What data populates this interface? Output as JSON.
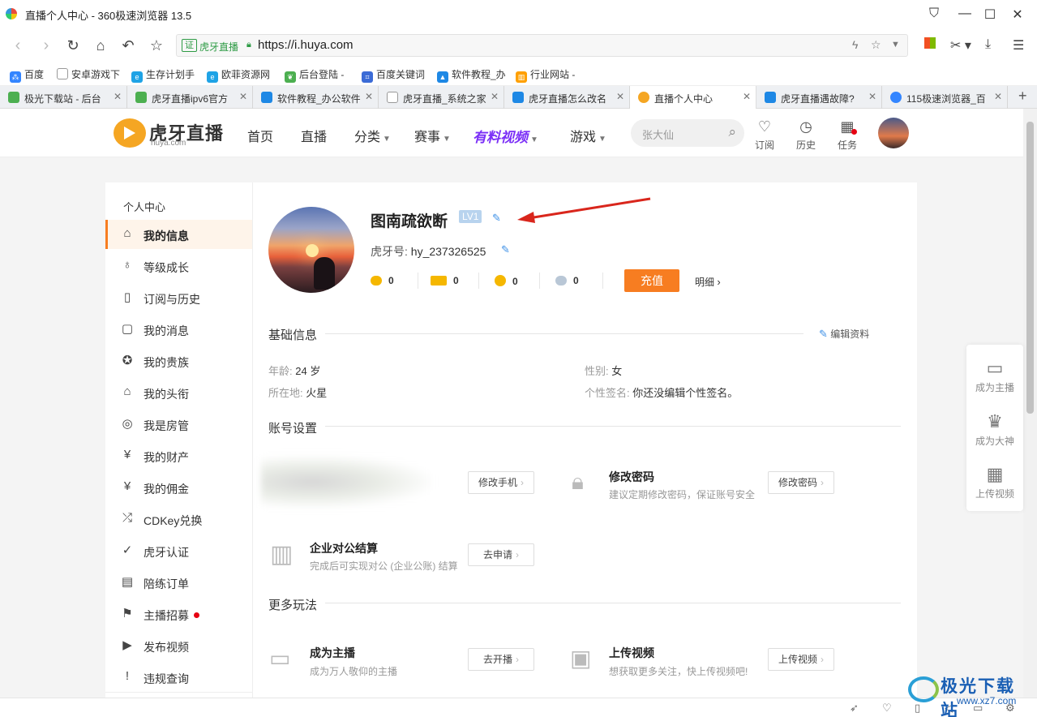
{
  "window": {
    "title": "直播个人中心 - 360极速浏览器 13.5",
    "controls": [
      "shirt-icon",
      "minimize-icon",
      "maximize-icon",
      "close-icon"
    ]
  },
  "address": {
    "cert": "证",
    "site_label": "虎牙直播",
    "url": "https://i.huya.com"
  },
  "bookmarks": [
    {
      "label": "百度",
      "icon": "baidu-icon",
      "color": "#3385ff"
    },
    {
      "label": "安卓游戏下",
      "icon": "page-icon",
      "color": "#9e9e9e"
    },
    {
      "label": "生存计划手",
      "icon": "edge-icon",
      "color": "#1fa3e6"
    },
    {
      "label": "欧菲资源网",
      "icon": "edge-icon",
      "color": "#1fa3e6"
    },
    {
      "label": "后台登陆 -",
      "icon": "leaf-icon",
      "color": "#4caf50"
    },
    {
      "label": "百度关键词",
      "icon": "crop-icon",
      "color": "#3b6bd6"
    },
    {
      "label": "软件教程_办",
      "icon": "cap-icon",
      "color": "#1e88e5"
    },
    {
      "label": "行业网站 -",
      "icon": "chart-icon",
      "color": "#ffa000"
    }
  ],
  "tabs": [
    {
      "label": "极光下载站 - 后台",
      "color": "#4caf50"
    },
    {
      "label": "虎牙直播ipv6官方",
      "color": "#4caf50"
    },
    {
      "label": "软件教程_办公软件",
      "color": "#1e88e5"
    },
    {
      "label": "虎牙直播_系统之家",
      "color": "#9e9e9e"
    },
    {
      "label": "虎牙直播怎么改名",
      "color": "#1e88e5"
    },
    {
      "label": "直播个人中心",
      "color": "#f5a623",
      "active": true
    },
    {
      "label": "虎牙直播遇故障?",
      "color": "#1e88e5"
    },
    {
      "label": "115极速浏览器_百",
      "color": "#3385ff"
    }
  ],
  "site": {
    "logo_text": "虎牙直播",
    "logo_sub": "huya.com",
    "nav": [
      {
        "label": "首页",
        "caret": false
      },
      {
        "label": "直播",
        "caret": false
      },
      {
        "label": "分类",
        "caret": true
      },
      {
        "label": "赛事",
        "caret": true
      },
      {
        "label": "有料视频",
        "caret": true
      },
      {
        "label": "游戏",
        "caret": true
      }
    ],
    "search_placeholder": "张大仙",
    "icons": [
      {
        "label": "订阅",
        "glyph": "♡"
      },
      {
        "label": "历史",
        "glyph": "◷"
      },
      {
        "label": "任务",
        "glyph": "▦"
      }
    ]
  },
  "sidebar": {
    "heading": "个人中心",
    "items": [
      {
        "label": "我的信息",
        "glyph": "⌂",
        "active": true
      },
      {
        "label": "等级成长",
        "glyph": "♁"
      },
      {
        "label": "订阅与历史",
        "glyph": "▯"
      },
      {
        "label": "我的消息",
        "glyph": "▢"
      },
      {
        "label": "我的贵族",
        "glyph": "✪"
      },
      {
        "label": "我的头衔",
        "glyph": "⌂"
      },
      {
        "label": "我是房管",
        "glyph": "◎"
      },
      {
        "label": "我的财产",
        "glyph": "¥"
      },
      {
        "label": "我的佣金",
        "glyph": "¥"
      },
      {
        "label": "CDKey兑换",
        "glyph": "⤮"
      },
      {
        "label": "虎牙认证",
        "glyph": "✓"
      },
      {
        "label": "陪练订单",
        "glyph": "▤"
      },
      {
        "label": "主播招募",
        "glyph": "⚑",
        "dot": true
      },
      {
        "label": "发布视频",
        "glyph": "▶"
      },
      {
        "label": "违规查询",
        "glyph": "!"
      }
    ]
  },
  "profile": {
    "name": "图南疏欲断",
    "level": "LV1",
    "hy_label": "虎牙号:",
    "hy_id": "hy_237326525",
    "coins": [
      "0",
      "0",
      "0",
      "0"
    ],
    "recharge": "充值",
    "detail": "明细"
  },
  "basic": {
    "title": "基础信息",
    "edit": "编辑资料",
    "age_label": "年龄:",
    "age_value": "24 岁",
    "gender_label": "性别:",
    "gender_value": "女",
    "loc_label": "所在地:",
    "loc_value": "火星",
    "sig_label": "个性签名:",
    "sig_value": "你还没编辑个性签名。"
  },
  "account": {
    "title": "账号设置",
    "phone_btn": "修改手机",
    "pwd_title": "修改密码",
    "pwd_desc": "建议定期修改密码，保证账号安全",
    "pwd_btn": "修改密码",
    "corp_title": "企业对公结算",
    "corp_desc": "完成后可实现对公 (企业公账) 结算",
    "corp_btn": "去申请"
  },
  "more": {
    "title": "更多玩法",
    "anchor_title": "成为主播",
    "anchor_desc": "成为万人敬仰的主播",
    "anchor_btn": "去开播",
    "video_title": "上传视频",
    "video_desc": "想获取更多关注，快上传视频吧!",
    "video_btn": "上传视频"
  },
  "float": [
    {
      "label": "成为主播",
      "glyph": "▭"
    },
    {
      "label": "成为大神",
      "glyph": "♛"
    },
    {
      "label": "上传视频",
      "glyph": "▦"
    }
  ],
  "watermark": {
    "main": "极光下载站",
    "sub": "www.xz7.com"
  },
  "colors": {
    "accent": "#f77d21",
    "link": "#3a8ee6",
    "active_bg": "#fef4ea"
  }
}
